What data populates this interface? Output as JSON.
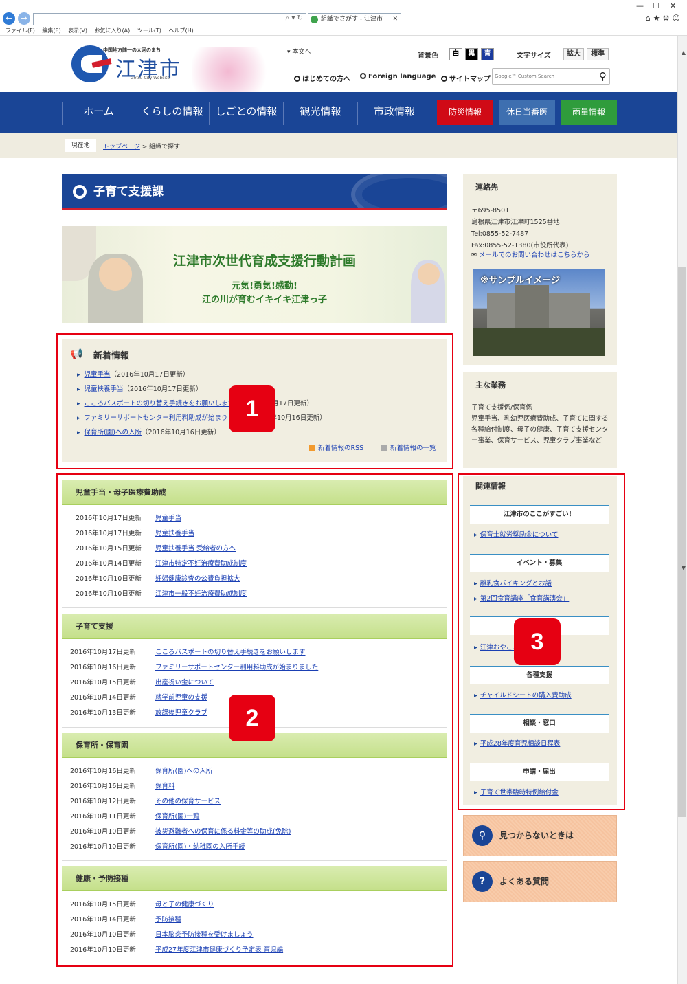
{
  "browser": {
    "tab_title": "組織でさがす - 江津市",
    "menu": [
      "ファイル(F)",
      "編集(E)",
      "表示(V)",
      "お気に入り(A)",
      "ツール(T)",
      "ヘルプ(H)"
    ],
    "icons": [
      "back-icon",
      "forward-icon",
      "search-icon",
      "refresh-icon",
      "home-icon",
      "star-icon",
      "gear-icon",
      "smiley-icon"
    ]
  },
  "header": {
    "tagline": "中国地方随一の大河のまち",
    "site_name": "江津市",
    "site_name_en": "Gotsu City Website",
    "skip_link": "本文へ",
    "bg_color_label": "背景色",
    "bg_white": "白",
    "bg_black": "黒",
    "bg_blue": "青",
    "font_size_label": "文字サイズ",
    "font_larger": "拡大",
    "font_standard": "標準",
    "links": [
      "はじめての方へ",
      "Foreign language",
      "サイトマップ"
    ],
    "search_placeholder": "Google™ Custom Search"
  },
  "nav": {
    "items": [
      "ホーム",
      "くらしの情報",
      "しごとの情報",
      "観光情報",
      "市政情報"
    ],
    "emergency": "防災情報",
    "holiday": "休日当番医",
    "rain": "雨量情報"
  },
  "breadcrumb": {
    "here_label": "現在地",
    "top": "トップページ",
    "current": " > 組織で探す"
  },
  "main": {
    "page_title": "子育て支援課",
    "banner": {
      "title": "江津市次世代育成支援行動計画",
      "line1": "元気!勇気!感動!",
      "line2": "江の川が育むイキイキ江津っ子"
    },
    "news": {
      "heading": "新着情報",
      "items": [
        {
          "link": "児童手当",
          "date": "（2016年10月17日更新）"
        },
        {
          "link": "児童扶養手当",
          "date": "（2016年10月17日更新）"
        },
        {
          "link": "こころパスポートの切り替え手続きをお願いします",
          "date": "（2016年10月17日更新）"
        },
        {
          "link": "ファミリーサポートセンター利用料助成が始まりました",
          "date": "（2016年10月16日更新）"
        },
        {
          "link": "保育所(園)への入所",
          "date": "（2016年10月16日更新）"
        }
      ],
      "rss": "新着情報のRSS",
      "list": "新着情報の一覧"
    },
    "categories": [
      {
        "title": "児童手当・母子医療費助成",
        "rows": [
          {
            "date": "2016年10月17日更新",
            "link": "児童手当"
          },
          {
            "date": "2016年10月17日更新",
            "link": "児童扶養手当"
          },
          {
            "date": "2016年10月15日更新",
            "link": "児童扶養手当 受給者の方へ"
          },
          {
            "date": "2016年10月14日更新",
            "link": "江津市特定不妊治療費助成制度"
          },
          {
            "date": "2016年10月10日更新",
            "link": "妊婦健康診査の公費負担拡大"
          },
          {
            "date": "2016年10月10日更新",
            "link": "江津市一般不妊治療費助成制度"
          }
        ]
      },
      {
        "title": "子育て支援",
        "rows": [
          {
            "date": "2016年10月17日更新",
            "link": "こころパスポートの切り替え手続きをお願いします"
          },
          {
            "date": "2016年10月16日更新",
            "link": "ファミリーサポートセンター利用料助成が始まりました"
          },
          {
            "date": "2016年10月15日更新",
            "link": "出産祝い金について"
          },
          {
            "date": "2016年10月14日更新",
            "link": "就学前児童の支援"
          },
          {
            "date": "2016年10月13日更新",
            "link": "放課後児童クラブ"
          }
        ]
      },
      {
        "title": "保育所・保育園",
        "rows": [
          {
            "date": "2016年10月16日更新",
            "link": "保育所(園)への入所"
          },
          {
            "date": "2016年10月16日更新",
            "link": "保育料"
          },
          {
            "date": "2016年10月12日更新",
            "link": "その他の保育サービス"
          },
          {
            "date": "2016年10月11日更新",
            "link": "保育所(園)一覧"
          },
          {
            "date": "2016年10月10日更新",
            "link": "被災避難者への保育に係る料金等の助成(免除)"
          },
          {
            "date": "2016年10月10日更新",
            "link": "保育所(園)・幼稚園の入所手続"
          }
        ]
      },
      {
        "title": "健康・予防接種",
        "rows": [
          {
            "date": "2016年10月15日更新",
            "link": "母と子の健康づくり"
          },
          {
            "date": "2016年10月14日更新",
            "link": "予防接種"
          },
          {
            "date": "2016年10月10日更新",
            "link": "日本脳炎予防接種を受けましょう"
          },
          {
            "date": "2016年10月10日更新",
            "link": "平成27年度江津市健康づくり予定表 育児編"
          }
        ]
      }
    ]
  },
  "sidebar": {
    "contact": {
      "heading": "連絡先",
      "postal": "〒695-8501",
      "address": "島根県江津市江津町1525番地",
      "tel": "Tel:0855-52-7487",
      "fax": "Fax:0855-52-1380(市役所代表)",
      "mail": "メールでのお問い合わせはこちらから",
      "photo_caption": "※サンプルイメージ"
    },
    "duties": {
      "heading": "主な業務",
      "line1": "子育て支援係/保育係",
      "text": "児童手当、乳幼児医療費助成、子育てに関する各種給付制度、母子の健康、子育て支援センター事業、保育サービス、児童クラブ事業など"
    },
    "related": {
      "heading": "関連情報",
      "groups": [
        {
          "title": "江津市のここがすごい！",
          "link": "保育士就労奨励金について"
        },
        {
          "title": "イベント・募集",
          "link": "離乳食バイキングとお話",
          "link2": "第2回食育講座「食育講演会」"
        },
        {
          "title": "",
          "link": "江津おやこ...方法"
        },
        {
          "title": "各種支援",
          "link": "チャイルドシートの購入費助成"
        },
        {
          "title": "相談・窓口",
          "link": "平成28年度育児相談日程表"
        },
        {
          "title": "申請・届出",
          "link": "子育て世帯臨時特例給付金"
        }
      ]
    },
    "notfound": "見つからないときは",
    "faq": "よくある質問"
  },
  "annotations": [
    "1",
    "2",
    "3"
  ],
  "colors": {
    "nav_blue": "#1a4596",
    "emergency_red": "#d00a16",
    "holiday_blue": "#3e6fb0",
    "rain_green": "#2f9c3c",
    "annotation_red": "#e60012"
  }
}
